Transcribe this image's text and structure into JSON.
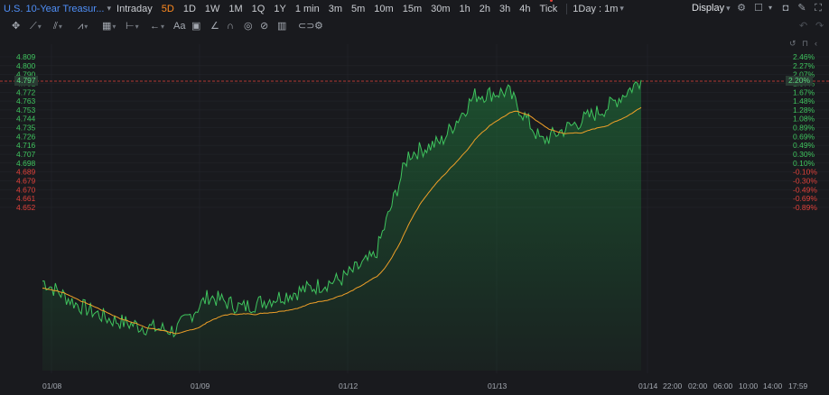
{
  "header": {
    "symbol": "U.S. 10-Year Treasur...",
    "timeframes": [
      "Intraday",
      "5D",
      "1D",
      "1W",
      "1M",
      "1Q",
      "1Y",
      "1 min",
      "3m",
      "5m",
      "10m",
      "15m",
      "30m",
      "1h",
      "2h",
      "3h",
      "4h",
      "Tick"
    ],
    "active_timeframe": "5D",
    "range": "1Day : 1m",
    "display": "Display"
  },
  "chart": {
    "price_ticks": [
      "4.809",
      "4.800",
      "4.790",
      "4.781",
      "4.772",
      "4.763",
      "4.753",
      "4.744",
      "4.735",
      "4.726",
      "4.716",
      "4.707",
      "4.698",
      "4.689",
      "4.679",
      "4.670",
      "4.661",
      "4.652"
    ],
    "pct_ticks": [
      "2.46%",
      "2.27%",
      "2.07%",
      "1.87%",
      "1.67%",
      "1.48%",
      "1.28%",
      "1.08%",
      "0.89%",
      "0.69%",
      "0.49%",
      "0.30%",
      "0.10%",
      "-0.10%",
      "-0.30%",
      "-0.49%",
      "-0.69%",
      "-0.89%"
    ],
    "current_price": "4.797",
    "current_pct": "2.20%",
    "x_labels": [
      "01/08",
      "01/09",
      "01/12",
      "01/13",
      "01/14",
      "22:00",
      "02:00",
      "06:00",
      "10:00",
      "14:00",
      "17:59"
    ],
    "colors": {
      "up": "#3fc45e",
      "down": "#e0413a",
      "avg_line": "#f0a028",
      "grid": "#23252a",
      "current_line": "#e0413a"
    }
  },
  "chart_data": {
    "type": "line",
    "x": [
      "01/08",
      "01/08",
      "01/08",
      "01/08",
      "01/08",
      "01/09",
      "01/09",
      "01/09",
      "01/09",
      "01/09",
      "01/12",
      "01/12",
      "01/12",
      "01/12",
      "01/13",
      "01/13",
      "01/13",
      "01/13",
      "01/13"
    ],
    "series": [
      {
        "values": [
          4.692,
          4.68,
          4.672,
          4.668,
          4.666,
          4.684,
          4.678,
          4.683,
          4.688,
          4.693,
          4.705,
          4.758,
          4.765,
          4.789,
          4.791,
          4.765,
          4.774,
          4.783,
          4.797
        ]
      }
    ],
    "ylim": [
      4.645,
      4.812
    ]
  }
}
